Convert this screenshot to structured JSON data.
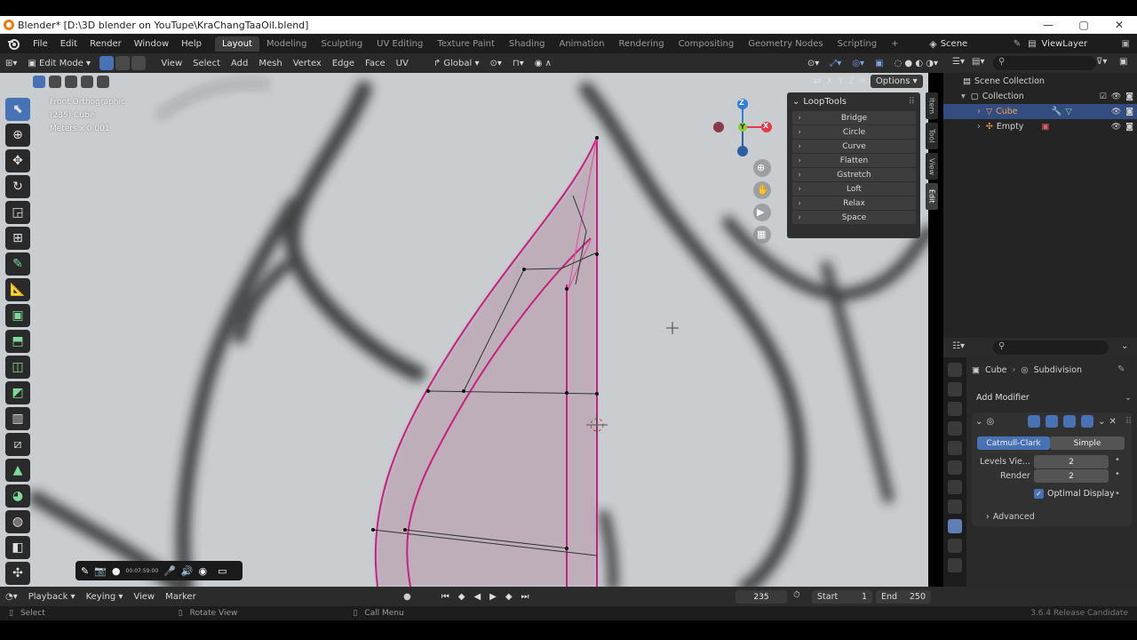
{
  "window": {
    "title": "Blender* [D:\\3D blender on YouTupe\\KraChangTaaOil.blend]",
    "controls": [
      "—",
      "▢",
      "✕"
    ]
  },
  "menu": [
    "File",
    "Edit",
    "Render",
    "Window",
    "Help"
  ],
  "workspaces": [
    "Layout",
    "Modeling",
    "Sculpting",
    "UV Editing",
    "Texture Paint",
    "Shading",
    "Animation",
    "Rendering",
    "Compositing",
    "Geometry Nodes",
    "Scripting",
    "+"
  ],
  "active_workspace": "Layout",
  "scene": {
    "label": "Scene",
    "view_layer": "ViewLayer"
  },
  "header": {
    "mode": "Edit Mode",
    "menus": [
      "View",
      "Select",
      "Add",
      "Mesh",
      "Vertex",
      "Edge",
      "Face",
      "UV"
    ],
    "orientation": "Global",
    "options": "Options",
    "axes": [
      "X",
      "Y",
      "Z"
    ]
  },
  "viewport": {
    "view_name": "Front Orthographic",
    "object_info": "(235) Cube",
    "scale": "Meters x 0.001",
    "gizmo": {
      "x": "X",
      "y": "Y",
      "z": "Z"
    }
  },
  "looptools": {
    "title": "LoopTools",
    "items": [
      "Bridge",
      "Circle",
      "Curve",
      "Flatten",
      "Gstretch",
      "Loft",
      "Relax",
      "Space"
    ]
  },
  "sidebar_tabs": [
    "Item",
    "Tool",
    "View",
    "Edit"
  ],
  "outliner": {
    "items": [
      {
        "label": "Scene Collection",
        "level": 0
      },
      {
        "label": "Collection",
        "level": 1
      },
      {
        "label": "Cube",
        "level": 2
      },
      {
        "label": "Empty",
        "level": 2
      }
    ]
  },
  "properties": {
    "breadcrumb_object": "Cube",
    "breadcrumb_modifier": "Subdivision",
    "add_modifier": "Add Modifier",
    "mode_catmull": "Catmull-Clark",
    "mode_simple": "Simple",
    "levels_label": "Levels Vie...",
    "levels_value": "2",
    "render_label": "Render",
    "render_value": "2",
    "optimal_display": "Optimal Display",
    "advanced": "Advanced"
  },
  "timeline": {
    "menus": [
      "Playback",
      "Keying",
      "View",
      "Marker"
    ],
    "current_frame": "235",
    "start_label": "Start",
    "start_value": "1",
    "end_label": "End",
    "end_value": "250"
  },
  "status": {
    "select": "Select",
    "rotate": "Rotate View",
    "call_menu": "Call Menu",
    "version": "3.6.4 Release Candidate"
  },
  "recorder": {
    "time": "00:07:59:00"
  },
  "colors": {
    "accent": "#4772b3",
    "mesh": "#c8207c",
    "background": "#c9cdd0",
    "highlight": "#334d80"
  }
}
